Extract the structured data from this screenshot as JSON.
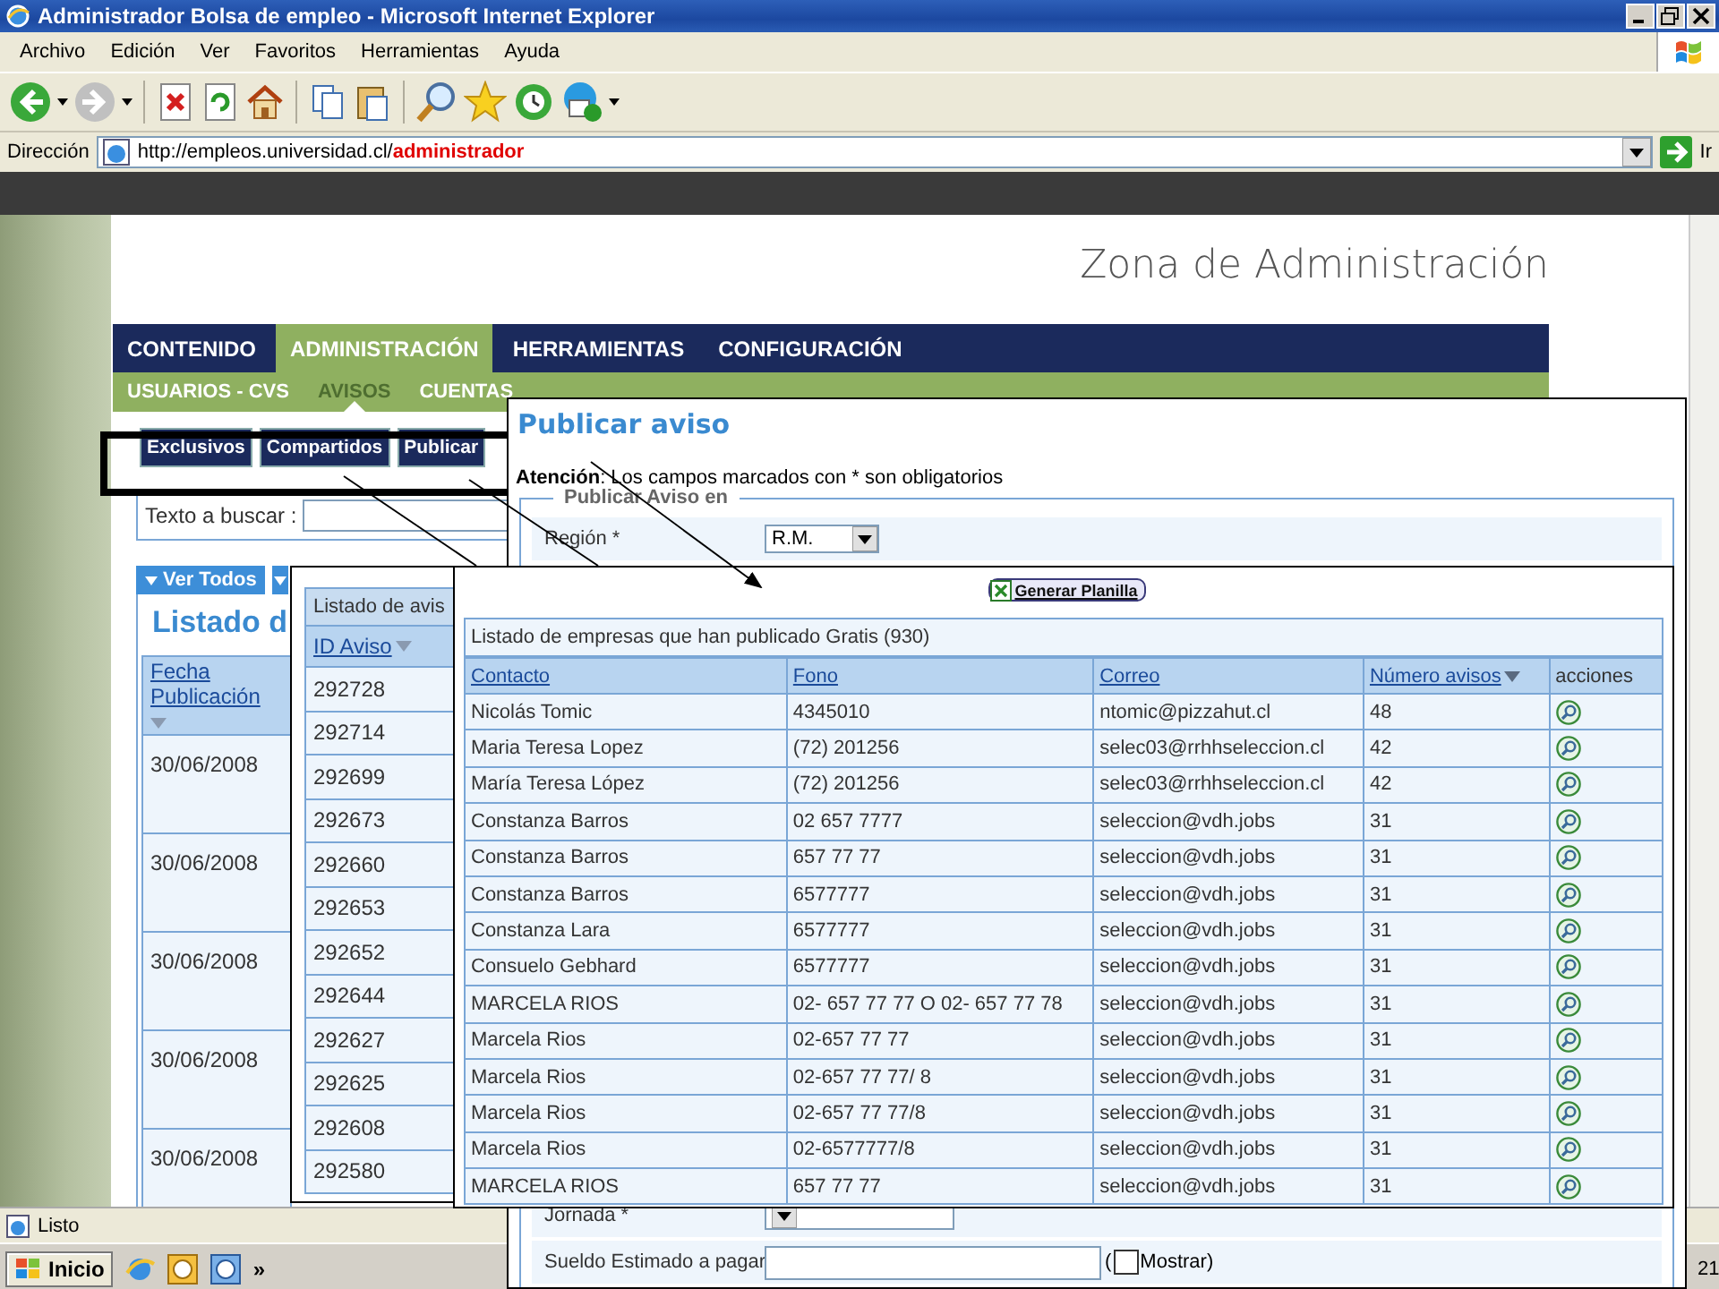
{
  "window": {
    "title": "Administrador Bolsa de empleo - Microsoft Internet Explorer"
  },
  "menu_bar": [
    "Archivo",
    "Edición",
    "Ver",
    "Favoritos",
    "Herramientas",
    "Ayuda"
  ],
  "address_bar": {
    "label": "Dirección",
    "url": "http://empleos.universidad.cl/",
    "url_highlight": "administrador",
    "go": "Ir"
  },
  "page": {
    "heading": "Zona de Administración",
    "tabs": [
      {
        "label": "CONTENIDO",
        "selected": false
      },
      {
        "label": "ADMINISTRACIÓN",
        "selected": true
      },
      {
        "label": "HERRAMIENTAS",
        "selected": false
      },
      {
        "label": "CONFIGURACIÓN",
        "selected": false
      }
    ],
    "subtabs": [
      {
        "label": "USUARIOS - CVS",
        "selected": false
      },
      {
        "label": "AVISOS",
        "selected": true
      },
      {
        "label": "CUENTAS",
        "selected": false
      }
    ],
    "buttons": [
      "Exclusivos",
      "Compartidos",
      "Publicar"
    ],
    "search": {
      "label": "Texto a buscar :"
    },
    "filter_button": "Ver Todos",
    "list_title": "Listado d",
    "table": {
      "column": "Fecha Publicación",
      "rows": [
        "30/06/2008",
        "30/06/2008",
        "30/06/2008",
        "30/06/2008",
        "30/06/2008"
      ]
    }
  },
  "avisos_panel": {
    "title": "Listado de avis",
    "column": "ID Aviso",
    "rows": [
      "292728",
      "292714",
      "292699",
      "292673",
      "292660",
      "292653",
      "292652",
      "292644",
      "292627",
      "292625",
      "292608",
      "292580"
    ]
  },
  "publicar_panel": {
    "title": "Publicar aviso",
    "notice": "**Atención**: Los campos marcados con * son obligatorios",
    "legend": "Publicar Aviso en",
    "top_fields": [
      {
        "label": "Región *",
        "kind": "select",
        "value": "R.M."
      }
    ],
    "bottom_fields": [
      {
        "label": "Jornada *",
        "kind": "select"
      },
      {
        "label": "Sueldo Estimado a pagar",
        "kind": "text",
        "checkbox": {
          "before": "(",
          "label": "Mostrar)",
          "checked": false
        }
      }
    ]
  },
  "empresas_panel": {
    "button": "Generar Planilla",
    "caption": "Listado de empresas que han publicado Gratis (930)",
    "columns": [
      {
        "label": "Contacto",
        "sorted": false
      },
      {
        "label": "Fono",
        "sorted": false
      },
      {
        "label": "Correo",
        "sorted": false
      },
      {
        "label": "Número avisos",
        "sorted": true
      },
      {
        "label": "acciones",
        "sorted": false
      }
    ],
    "rows": [
      [
        "Nicolás Tomic",
        "4345010",
        "ntomic@pizzahut.cl",
        "48"
      ],
      [
        "Maria Teresa Lopez",
        "(72) 201256",
        "selec03@rrhhseleccion.cl",
        "42"
      ],
      [
        "María Teresa López",
        "(72) 201256",
        "selec03@rrhhseleccion.cl",
        "42"
      ],
      [
        "Constanza Barros",
        "02 657 7777",
        "seleccion@vdh.jobs",
        "31"
      ],
      [
        "Constanza Barros",
        "657 77 77",
        "seleccion@vdh.jobs",
        "31"
      ],
      [
        "Constanza Barros",
        "6577777",
        "seleccion@vdh.jobs",
        "31"
      ],
      [
        "Constanza Lara",
        "6577777",
        "seleccion@vdh.jobs",
        "31"
      ],
      [
        "Consuelo Gebhard",
        "6577777",
        "seleccion@vdh.jobs",
        "31"
      ],
      [
        "MARCELA RIOS",
        "02- 657 77 77 O 02- 657 77 78",
        "seleccion@vdh.jobs",
        "31"
      ],
      [
        "Marcela Rios",
        "02-657 77 77",
        "seleccion@vdh.jobs",
        "31"
      ],
      [
        "Marcela Rios",
        "02-657 77 77/ 8",
        "seleccion@vdh.jobs",
        "31"
      ],
      [
        "Marcela Rios",
        "02-657 77 77/8",
        "seleccion@vdh.jobs",
        "31"
      ],
      [
        "Marcela Rios",
        "02-6577777/8",
        "seleccion@vdh.jobs",
        "31"
      ],
      [
        "MARCELA RIOS",
        "657 77 77",
        "seleccion@vdh.jobs",
        "31"
      ]
    ]
  },
  "status_bar": {
    "text": "Listo"
  },
  "taskbar": {
    "start": "Inicio",
    "more": "»",
    "clock": "21"
  }
}
